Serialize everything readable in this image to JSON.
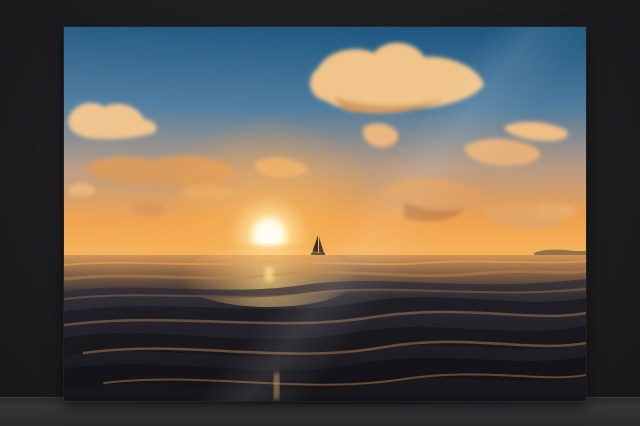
{
  "scene": {
    "subject": "sunset-over-ocean-print",
    "colors": {
      "sky_top": "#1f5a84",
      "sky_mid": "#6a8aa4",
      "sky_horizon": "#f4a24a",
      "sun_core": "#fff6d8",
      "cloud_light": "#f2c98f",
      "cloud_dark": "#c98a52",
      "water_dark": "#1a1a22",
      "water_glow": "#e89a4a",
      "wall": "#202022"
    },
    "icons": [
      "sailboat-icon",
      "sun-icon"
    ]
  }
}
